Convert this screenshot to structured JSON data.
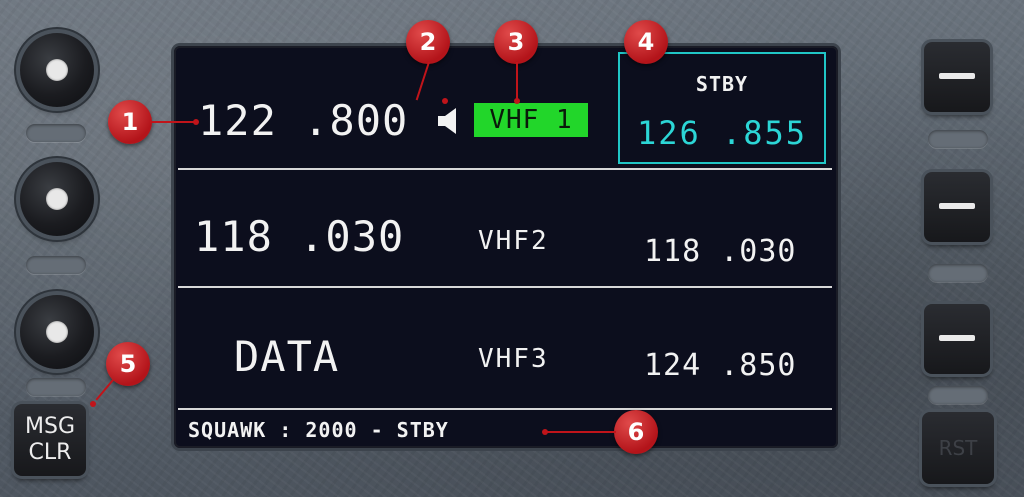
{
  "panel": {
    "active": {
      "frequency": "122 .800",
      "radio_tag": "VHF 1",
      "audio_icon": "speaker-icon"
    },
    "standby": {
      "title": "STBY",
      "frequency": "126 .855"
    },
    "rows": [
      {
        "left_value": "118 .030",
        "radio": "VHF2",
        "right_value": "118 .030"
      },
      {
        "left_value": "DATA",
        "radio": "VHF3",
        "right_value": "124 .850"
      }
    ],
    "squawk_line": "SQUAWK : 2000 - STBY"
  },
  "buttons": {
    "msg_clr_line1": "MSG",
    "msg_clr_line2": "CLR",
    "rst": "RST"
  },
  "callouts": [
    "1",
    "2",
    "3",
    "4",
    "5",
    "6"
  ],
  "colors": {
    "screen_bg": "#0c0e1d",
    "active_tag": "#22d62a",
    "standby_accent": "#2cd6d6",
    "callout": "#c0141a"
  }
}
